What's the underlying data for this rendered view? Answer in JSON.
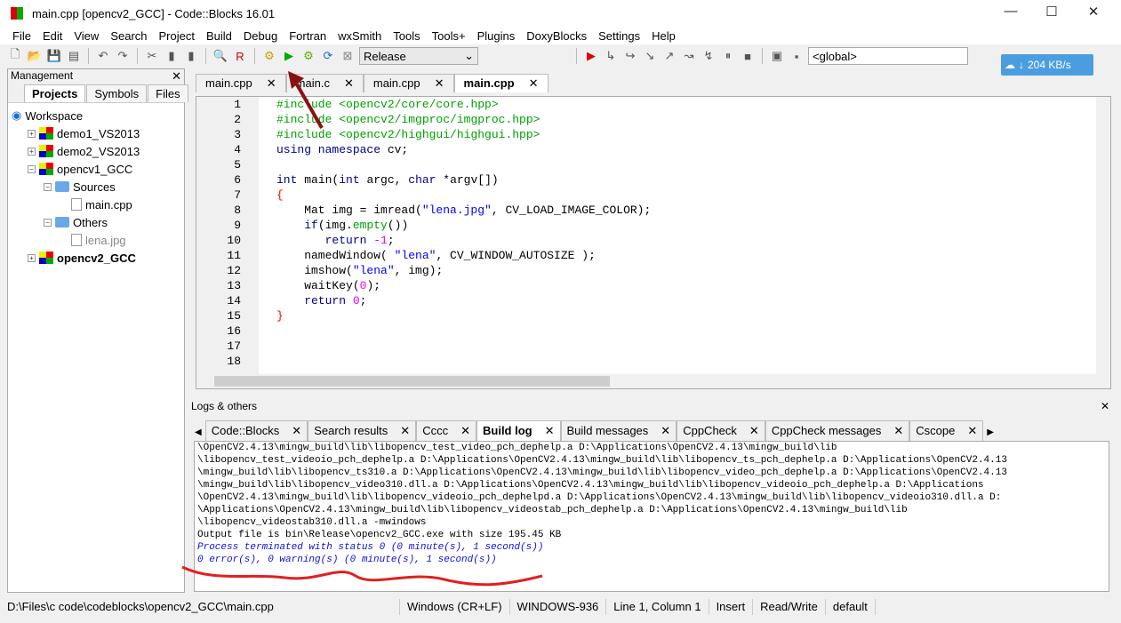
{
  "window": {
    "title": "main.cpp [opencv2_GCC] - Code::Blocks 16.01",
    "minimize": "—",
    "maximize": "☐",
    "close": "✕"
  },
  "menu": [
    "File",
    "Edit",
    "View",
    "Search",
    "Project",
    "Build",
    "Debug",
    "Fortran",
    "wxSmith",
    "Tools",
    "Tools+",
    "Plugins",
    "DoxyBlocks",
    "Settings",
    "Help"
  ],
  "toolbar": {
    "build_target": "Release",
    "scope": "<global>"
  },
  "speed": {
    "value": "204 KB/s"
  },
  "management": {
    "title": "Management",
    "tabs": [
      "Projects",
      "Symbols",
      "Files"
    ],
    "tree": [
      {
        "label": "Workspace",
        "level": 0,
        "icon": "workspace"
      },
      {
        "label": "demo1_VS2013",
        "level": 1,
        "icon": "project",
        "pm": "+"
      },
      {
        "label": "demo2_VS2013",
        "level": 1,
        "icon": "project",
        "pm": "+"
      },
      {
        "label": "opencv1_GCC",
        "level": 1,
        "icon": "project",
        "pm": "−"
      },
      {
        "label": "Sources",
        "level": 2,
        "icon": "folder",
        "pm": "−"
      },
      {
        "label": "main.cpp",
        "level": 3,
        "icon": "file"
      },
      {
        "label": "Others",
        "level": 2,
        "icon": "folder",
        "pm": "−"
      },
      {
        "label": "lena.jpg",
        "level": 3,
        "icon": "file"
      },
      {
        "label": "opencv2_GCC",
        "level": 1,
        "icon": "project",
        "pm": "+",
        "bold": true
      }
    ]
  },
  "editor": {
    "tabs": [
      {
        "label": "main.cpp"
      },
      {
        "label": "main.c"
      },
      {
        "label": "main.cpp"
      },
      {
        "label": "main.cpp",
        "active": true
      }
    ],
    "lines": [
      [
        [
          "#include ",
          "pp"
        ],
        [
          "<opencv2/core/core.hpp>",
          "pp"
        ]
      ],
      [
        [
          "#include ",
          "pp"
        ],
        [
          "<opencv2/imgproc/imgproc.hpp>",
          "pp"
        ]
      ],
      [
        [
          "#include ",
          "pp"
        ],
        [
          "<opencv2/highgui/highgui.hpp>",
          "pp"
        ]
      ],
      [
        [
          "using namespace ",
          "kw"
        ],
        [
          "cv;",
          "pl"
        ]
      ],
      [],
      [
        [
          "int ",
          "kw"
        ],
        [
          "main(",
          "pl"
        ],
        [
          "int ",
          "kw"
        ],
        [
          "argc, ",
          "pl"
        ],
        [
          "char ",
          "kw"
        ],
        [
          "*argv[])",
          "pl"
        ]
      ],
      [
        [
          "{",
          "op"
        ]
      ],
      [
        [
          "    Mat img = imread(",
          "pl"
        ],
        [
          "\"lena.jpg\"",
          "str"
        ],
        [
          ", CV_LOAD_IMAGE_COLOR);",
          "pl"
        ]
      ],
      [
        [
          "    if",
          "kw"
        ],
        [
          "(img.",
          "pl"
        ],
        [
          "empty",
          "pp"
        ],
        [
          "())",
          "pl"
        ]
      ],
      [
        [
          "       return ",
          "kw"
        ],
        [
          "-1",
          "num"
        ],
        [
          ";",
          "pl"
        ]
      ],
      [
        [
          "    namedWindow( ",
          "pl"
        ],
        [
          "\"lena\"",
          "str"
        ],
        [
          ", CV_WINDOW_AUTOSIZE );",
          "pl"
        ]
      ],
      [
        [
          "    imshow(",
          "pl"
        ],
        [
          "\"lena\"",
          "str"
        ],
        [
          ", img);",
          "pl"
        ]
      ],
      [
        [
          "    waitKey(",
          "pl"
        ],
        [
          "0",
          "num"
        ],
        [
          ");",
          "pl"
        ]
      ],
      [
        [
          "    return ",
          "kw"
        ],
        [
          "0",
          "num"
        ],
        [
          ";",
          "pl"
        ]
      ],
      [
        [
          "}",
          "op"
        ]
      ],
      [],
      [],
      []
    ]
  },
  "logs": {
    "title": "Logs & others",
    "tabs": [
      {
        "label": "Code::Blocks"
      },
      {
        "label": "Search results"
      },
      {
        "label": "Cccc"
      },
      {
        "label": "Build log",
        "active": true
      },
      {
        "label": "Build messages"
      },
      {
        "label": "CppCheck"
      },
      {
        "label": "CppCheck messages"
      },
      {
        "label": "Cscope"
      }
    ],
    "lines": [
      {
        "text": "\\OpenCV2.4.13\\mingw_build\\lib\\libopencv_test_video_pch_dephelp.a D:\\Applications\\OpenCV2.4.13\\mingw_build\\lib"
      },
      {
        "text": "\\libopencv_test_videoio_pch_dephelp.a D:\\Applications\\OpenCV2.4.13\\mingw_build\\lib\\libopencv_ts_pch_dephelp.a D:\\Applications\\OpenCV2.4.13"
      },
      {
        "text": "\\mingw_build\\lib\\libopencv_ts310.a D:\\Applications\\OpenCV2.4.13\\mingw_build\\lib\\libopencv_video_pch_dephelp.a D:\\Applications\\OpenCV2.4.13"
      },
      {
        "text": "\\mingw_build\\lib\\libopencv_video310.dll.a D:\\Applications\\OpenCV2.4.13\\mingw_build\\lib\\libopencv_videoio_pch_dephelp.a D:\\Applications"
      },
      {
        "text": "\\OpenCV2.4.13\\mingw_build\\lib\\libopencv_videoio_pch_dephelpd.a D:\\Applications\\OpenCV2.4.13\\mingw_build\\lib\\libopencv_videoio310.dll.a D:"
      },
      {
        "text": "\\Applications\\OpenCV2.4.13\\mingw_build\\lib\\libopencv_videostab_pch_dephelp.a D:\\Applications\\OpenCV2.4.13\\mingw_build\\lib"
      },
      {
        "text": "\\libopencv_videostab310.dll.a -mwindows"
      },
      {
        "text": "Output file is bin\\Release\\opencv2_GCC.exe with size 195.45 KB"
      },
      {
        "text": "Process terminated with status 0 (0 minute(s), 1 second(s))",
        "blue": true
      },
      {
        "text": "0 error(s), 0 warning(s) (0 minute(s), 1 second(s))",
        "blue": true
      }
    ]
  },
  "status": [
    "D:\\Files\\c code\\codeblocks\\opencv2_GCC\\main.cpp",
    "Windows (CR+LF)",
    "WINDOWS-936",
    "Line 1, Column 1",
    "Insert",
    "Read/Write",
    "default"
  ],
  "colors": {
    "annotation_red": "#e02020",
    "log_blue": "#1010e0",
    "arrow": "#8b1010"
  }
}
